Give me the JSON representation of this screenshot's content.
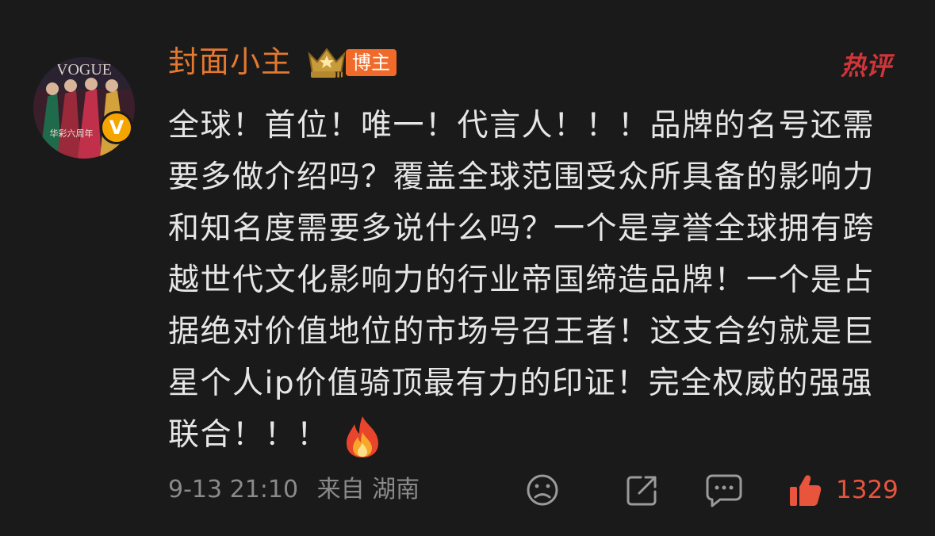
{
  "user": {
    "name": "封面小主",
    "tag": "博主",
    "verified_mark": "V",
    "level_roman": "III",
    "avatar_magazine": "VOGUE",
    "avatar_caption": "华彩六周年"
  },
  "hot_label": "热评",
  "post": {
    "text": "全球！首位！唯一！代言人！！！品牌的名号还需要多做介绍吗？覆盖全球范围受众所具备的影响力和知名度需要多说什么吗？一个是享誉全球拥有跨越世代文化影响力的行业帝国缔造品牌！一个是占据绝对价值地位的市场号召王者！这支合约就是巨星个人ip价值骑顶最有力的印证！完全权威的强强联合！！！"
  },
  "meta": {
    "timestamp": "9-13 21:10",
    "source": "来自 湖南"
  },
  "actions": {
    "likes": "1329"
  },
  "colors": {
    "background": "#1a1a1a",
    "username": "#e5782f",
    "tag": "#f06a2a",
    "hot": "#d0353a",
    "text": "#e6e6e6",
    "meta": "#8a8a8a",
    "like": "#e8543c"
  },
  "icons": [
    "crown-level-icon",
    "sad-face-icon",
    "share-icon",
    "comment-icon",
    "thumbs-up-icon",
    "fire-emoji-icon"
  ]
}
